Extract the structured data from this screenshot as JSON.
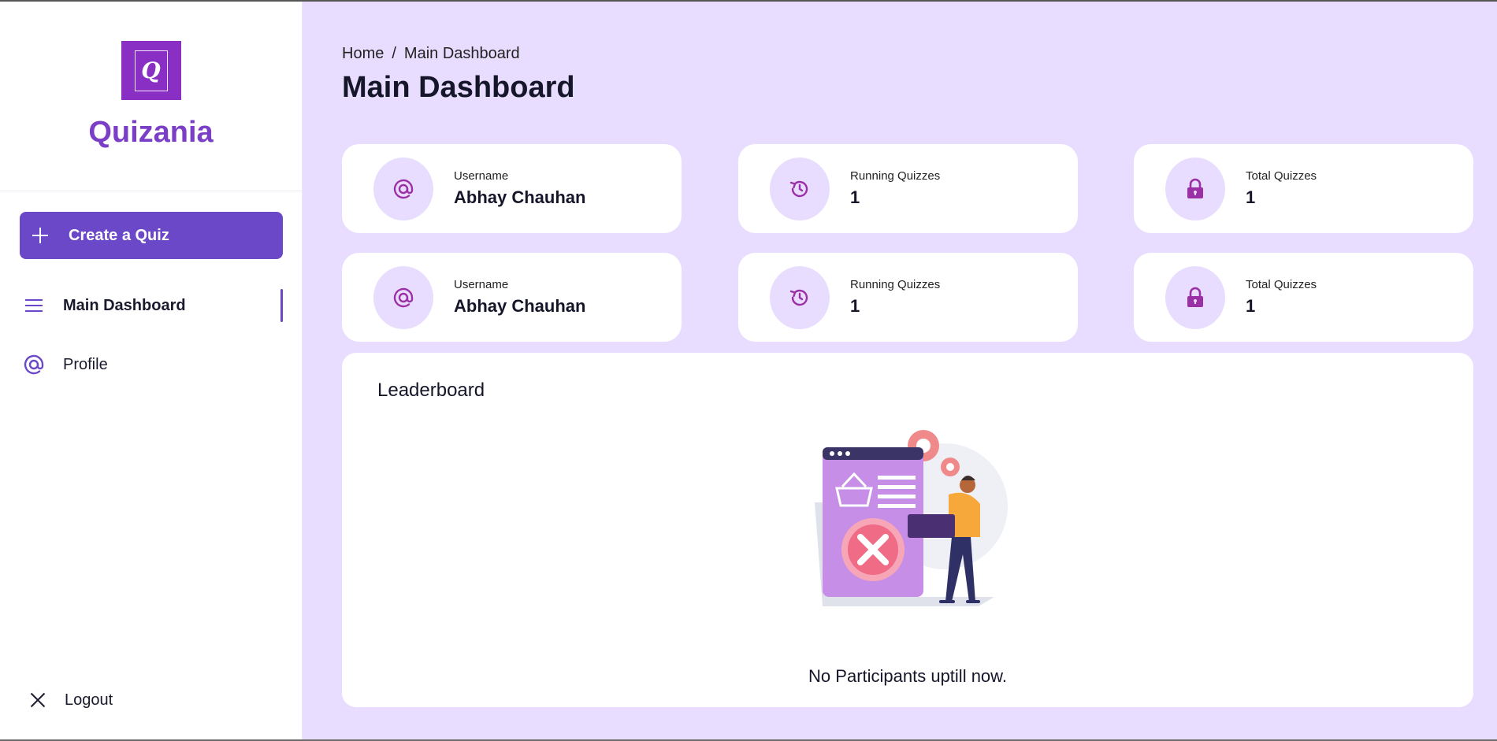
{
  "app": {
    "name": "Quizania",
    "logo_letter": "Q"
  },
  "colors": {
    "brand": "#6b48c8",
    "background": "#e8ddff",
    "icon": "#9b2fa5"
  },
  "sidebar": {
    "create_label": "Create a Quiz",
    "items": [
      {
        "label": "Main Dashboard",
        "icon": "hamburger-icon",
        "active": true
      },
      {
        "label": "Profile",
        "icon": "at-icon",
        "active": false
      }
    ],
    "logout_label": "Logout"
  },
  "header": {
    "breadcrumb": [
      "Home",
      "Main Dashboard"
    ],
    "breadcrumb_sep": "/",
    "title": "Main Dashboard"
  },
  "cards": [
    {
      "label": "Username",
      "value": "Abhay Chauhan",
      "icon": "at-icon"
    },
    {
      "label": "Running Quizzes",
      "value": "1",
      "icon": "history-icon"
    },
    {
      "label": "Total Quizzes",
      "value": "1",
      "icon": "lock-icon"
    },
    {
      "label": "Username",
      "value": "Abhay Chauhan",
      "icon": "at-icon"
    },
    {
      "label": "Running Quizzes",
      "value": "1",
      "icon": "history-icon"
    },
    {
      "label": "Total Quizzes",
      "value": "1",
      "icon": "lock-icon"
    }
  ],
  "leaderboard": {
    "title": "Leaderboard",
    "empty_message": "No Participants uptill now."
  }
}
